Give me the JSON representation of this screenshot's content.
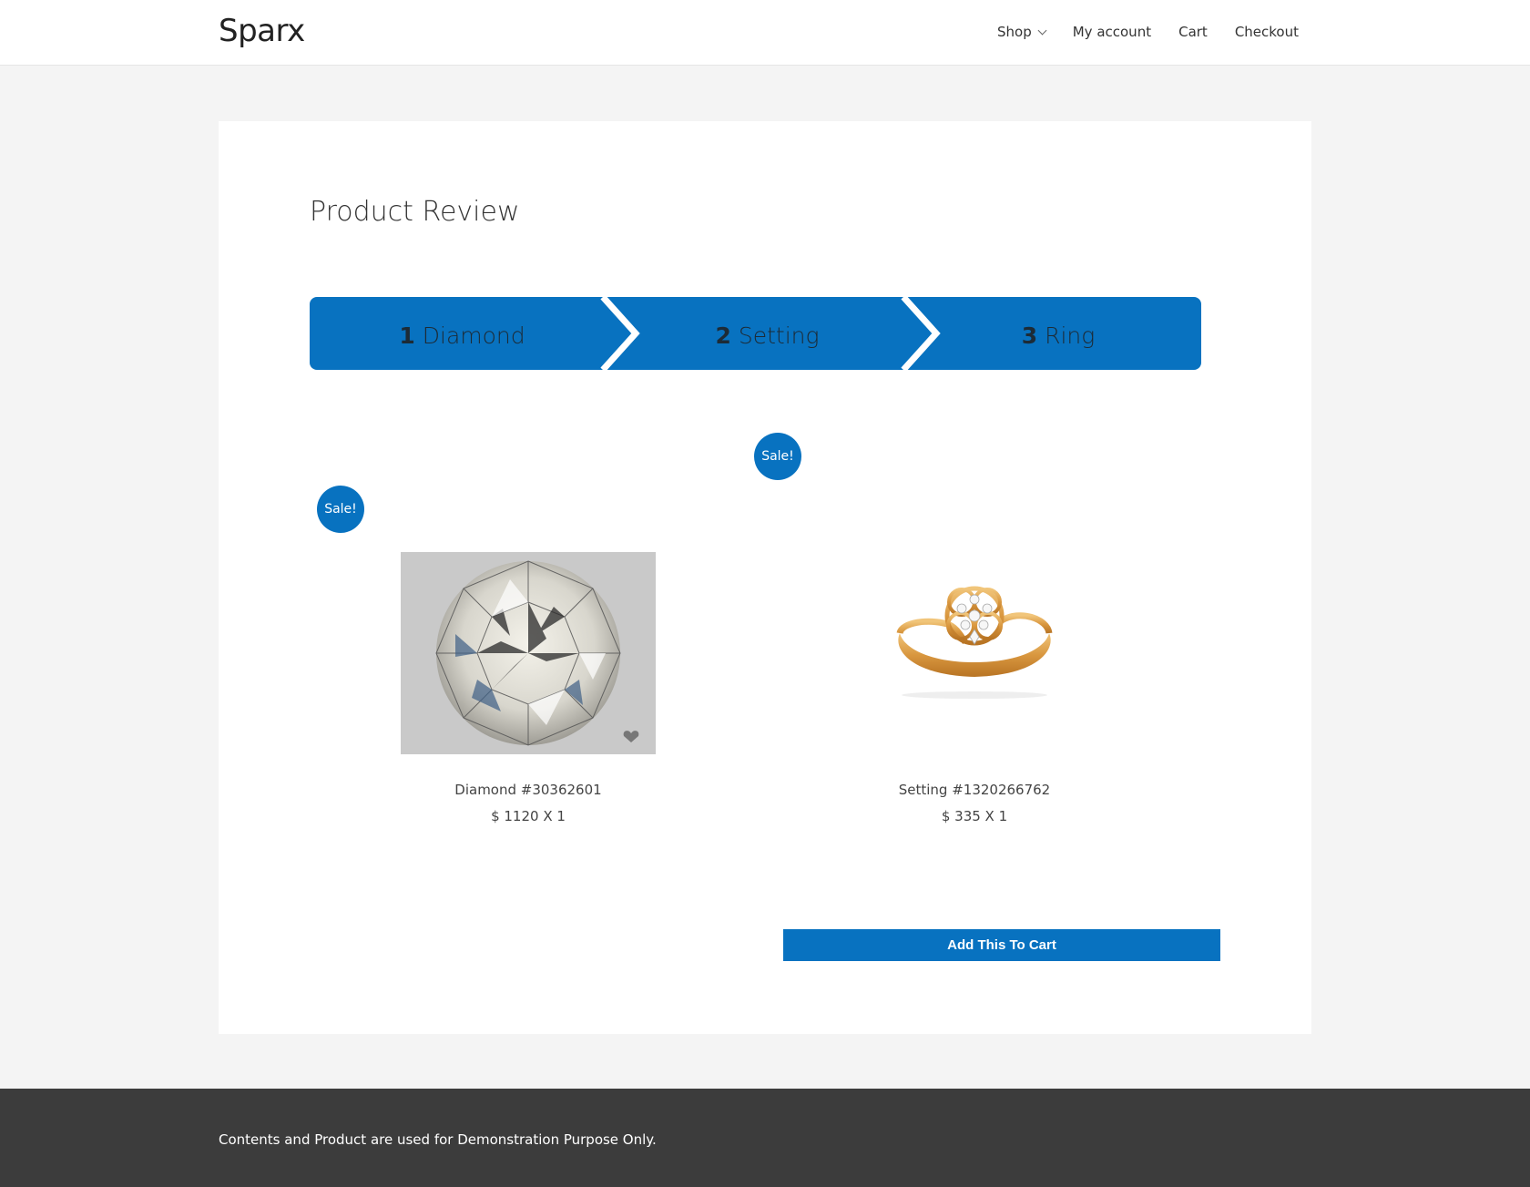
{
  "header": {
    "site_title": "Sparx",
    "nav": [
      {
        "label": "Shop"
      },
      {
        "label": "My account"
      },
      {
        "label": "Cart"
      },
      {
        "label": "Checkout"
      }
    ]
  },
  "main": {
    "title": "Product Review",
    "steps": [
      {
        "number": "1",
        "label": "Diamond"
      },
      {
        "number": "2",
        "label": "Setting"
      },
      {
        "number": "3",
        "label": "Ring"
      }
    ],
    "products": [
      {
        "badge": "Sale!",
        "name": "Diamond #30362601",
        "price": "$ 1120 X 1",
        "image_alt": "round diamond"
      },
      {
        "badge": "Sale!",
        "name": "Setting #1320266762",
        "price": "$ 335 X 1",
        "image_alt": "gold ring setting"
      }
    ],
    "add_to_cart_label": "Add This To Cart"
  },
  "footer": {
    "text": "Contents and Product are used for Demonstration Purpose Only."
  },
  "colors": {
    "accent": "#0872c0",
    "footer_bg": "#3c3c3c",
    "page_bg": "#f4f4f4"
  }
}
